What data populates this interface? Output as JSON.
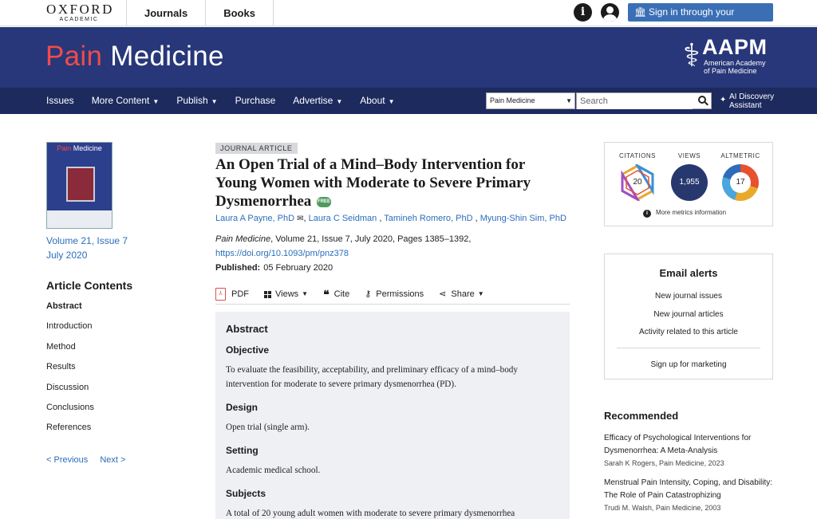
{
  "top": {
    "logo_main": "OXFORD",
    "logo_sub": "ACADEMIC",
    "nav": [
      "Journals",
      "Books"
    ],
    "signin": "Sign in through your institution"
  },
  "header": {
    "brand_part1": "Pain",
    "brand_part2": "Medicine",
    "society_abbr": "AAPM",
    "society_line1": "American Academy",
    "society_line2": "of Pain Medicine"
  },
  "nav": {
    "items": [
      {
        "label": "Issues",
        "dropdown": false
      },
      {
        "label": "More Content",
        "dropdown": true
      },
      {
        "label": "Publish",
        "dropdown": true
      },
      {
        "label": "Purchase",
        "dropdown": false
      },
      {
        "label": "Advertise",
        "dropdown": true
      },
      {
        "label": "About",
        "dropdown": true
      }
    ],
    "journal_select": "Pain Medicine",
    "search_placeholder": "Search",
    "ai_line1": "AI Discovery",
    "ai_line2": "Assistant"
  },
  "sidebar": {
    "cover_title_1": "Pain",
    "cover_title_2": "Medicine",
    "volume": "Volume 21, Issue 7",
    "date": "July 2020",
    "contents_heading": "Article Contents",
    "toc": [
      "Abstract",
      "Introduction",
      "Method",
      "Results",
      "Discussion",
      "Conclusions",
      "References"
    ],
    "prev": "< Previous",
    "next": "Next >"
  },
  "article": {
    "type": "JOURNAL ARTICLE",
    "title": "An Open Trial of a Mind–Body Intervention for Young Women with Moderate to Severe Primary Dysmenorrhea",
    "free": "FREE",
    "authors": [
      "Laura A Payne, PhD",
      "Laura C Seidman",
      "Tamineh Romero, PhD",
      "Myung-Shin Sim, PhD"
    ],
    "journal": "Pain Medicine",
    "citation_rest": ", Volume 21, Issue 7, July 2020, Pages 1385–1392,",
    "doi": "https://doi.org/10.1093/pm/pnz378",
    "published_label": "Published:",
    "published_date": "05 February 2020"
  },
  "toolbar": {
    "pdf": "PDF",
    "views": "Views",
    "cite": "Cite",
    "permissions": "Permissions",
    "share": "Share"
  },
  "abstract": {
    "heading": "Abstract",
    "sections": [
      {
        "heading": "Objective",
        "text": "To evaluate the feasibility, acceptability, and preliminary efficacy of a mind–body intervention for moderate to severe primary dysmenorrhea (PD)."
      },
      {
        "heading": "Design",
        "text": "Open trial (single arm)."
      },
      {
        "heading": "Setting",
        "text": "Academic medical school."
      },
      {
        "heading": "Subjects",
        "text": "A total of 20 young adult women with moderate to severe primary dysmenorrhea"
      }
    ]
  },
  "metrics": {
    "citations_label": "CITATIONS",
    "citations": "20",
    "views_label": "VIEWS",
    "views": "1,955",
    "altmetric_label": "ALTMETRIC",
    "altmetric": "17",
    "more": "More metrics information"
  },
  "alerts": {
    "heading": "Email alerts",
    "items": [
      "New journal issues",
      "New journal articles",
      "Activity related to this article"
    ],
    "marketing": "Sign up for marketing"
  },
  "recommended": {
    "heading": "Recommended",
    "items": [
      {
        "title_1": "Efficacy of Psychological Interventions for",
        "title_2": "Dysmenorrhea: A Meta-Analysis",
        "meta": "Sarah K Rogers, Pain Medicine, 2023"
      },
      {
        "title_1": "Menstrual Pain Intensity, Coping, and Disability:",
        "title_2": "The Role of Pain Catastrophizing",
        "meta": "Trudi M. Walsh, Pain Medicine, 2003"
      }
    ]
  }
}
